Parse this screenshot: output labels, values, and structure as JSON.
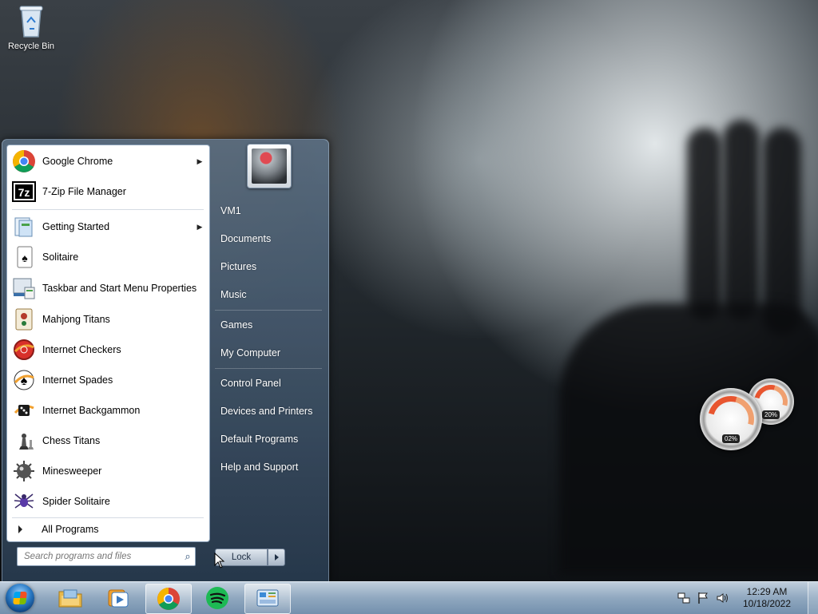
{
  "desktop": {
    "icons": [
      {
        "label": "Recycle Bin",
        "icon": "recycle-bin-icon"
      }
    ],
    "gadget": {
      "cpu_value": "02%",
      "memory_value": "20%"
    }
  },
  "start_menu": {
    "programs": [
      {
        "label": "Google Chrome",
        "icon": "chrome-icon",
        "submenu": true
      },
      {
        "label": "7-Zip File Manager",
        "icon": "7zip-icon",
        "submenu": false
      },
      {
        "label": "Getting Started",
        "icon": "getting-started-icon",
        "submenu": true
      },
      {
        "label": "Solitaire",
        "icon": "solitaire-icon",
        "submenu": false
      },
      {
        "label": "Taskbar and Start Menu Properties",
        "icon": "taskbar-properties-icon",
        "submenu": false
      },
      {
        "label": "Mahjong Titans",
        "icon": "mahjong-icon",
        "submenu": false
      },
      {
        "label": "Internet Checkers",
        "icon": "checkers-icon",
        "submenu": false
      },
      {
        "label": "Internet Spades",
        "icon": "spades-icon",
        "submenu": false
      },
      {
        "label": "Internet Backgammon",
        "icon": "backgammon-icon",
        "submenu": false
      },
      {
        "label": "Chess Titans",
        "icon": "chess-icon",
        "submenu": false
      },
      {
        "label": "Minesweeper",
        "icon": "minesweeper-icon",
        "submenu": false
      },
      {
        "label": "Spider Solitaire",
        "icon": "spider-icon",
        "submenu": false
      }
    ],
    "all_programs": "All Programs",
    "search": {
      "placeholder": "Search programs and files",
      "value": ""
    },
    "right_links": [
      {
        "label": "VM1"
      },
      {
        "label": "Documents"
      },
      {
        "label": "Pictures"
      },
      {
        "label": "Music"
      },
      {
        "label": "Games"
      },
      {
        "label": "My Computer"
      },
      {
        "label": "Control Panel"
      },
      {
        "label": "Devices and Printers"
      },
      {
        "label": "Default Programs"
      },
      {
        "label": "Help and Support"
      }
    ],
    "power": {
      "label": "Lock"
    }
  },
  "taskbar": {
    "pinned": [
      {
        "name": "windows-explorer",
        "icon": "folder-icon",
        "active": false
      },
      {
        "name": "media-player",
        "icon": "media-player-icon",
        "active": false
      },
      {
        "name": "chrome",
        "icon": "chrome-icon",
        "active": true
      },
      {
        "name": "spotify",
        "icon": "spotify-icon",
        "active": false
      },
      {
        "name": "control-panel",
        "icon": "control-panel-icon",
        "active": true
      }
    ],
    "clock": {
      "time": "12:29 AM",
      "date": "10/18/2022"
    }
  },
  "colors": {
    "accent": "#2a7bc6",
    "chrome_red": "#db4437",
    "spotify_green": "#1db954"
  }
}
